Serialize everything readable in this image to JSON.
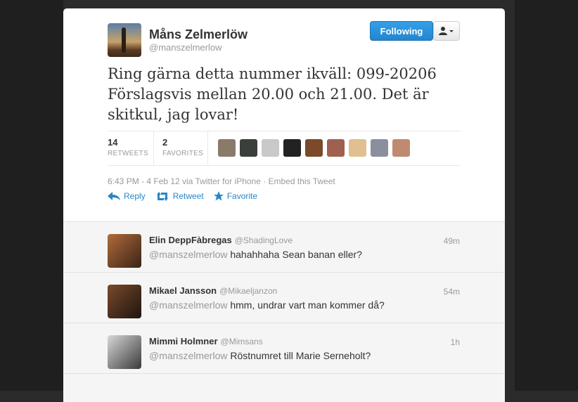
{
  "tweet": {
    "author_name": "Måns Zelmerlöw",
    "author_handle": "@manszelmerlow",
    "follow_label": "Following",
    "text": "Ring gärna detta nummer ikväll: 099-20206 Förslagsvis mellan 20.00 och 21.00. Det är skitkul, jag lovar!",
    "retweets": "14",
    "retweets_label": "RETWEETS",
    "favorites": "2",
    "favorites_label": "FAVORITES",
    "meta": "6:43 PM - 4 Feb 12 via Twitter for iPhone · Embed this Tweet",
    "actions": {
      "reply": "Reply",
      "retweet": "Retweet",
      "favorite": "Favorite"
    }
  },
  "replies": [
    {
      "name": "Elin DeppFàbregas",
      "handle": "@ShadingLove",
      "time": "49m",
      "mention": "@manszelmerlow",
      "text": " hahahhaha Sean banan eller?"
    },
    {
      "name": "Mikael Jansson",
      "handle": "@Mikaeljanzon",
      "time": "54m",
      "mention": "@manszelmerlow",
      "text": " hmm, undrar vart man kommer då?"
    },
    {
      "name": "Mimmi Holmner",
      "handle": "@Mimsans",
      "time": "1h",
      "mention": "@manszelmerlow",
      "text": " Röstnumret till Marie Serneholt?"
    }
  ],
  "colors": {
    "accent": "#2a86c8",
    "follow": "#2485cd"
  }
}
